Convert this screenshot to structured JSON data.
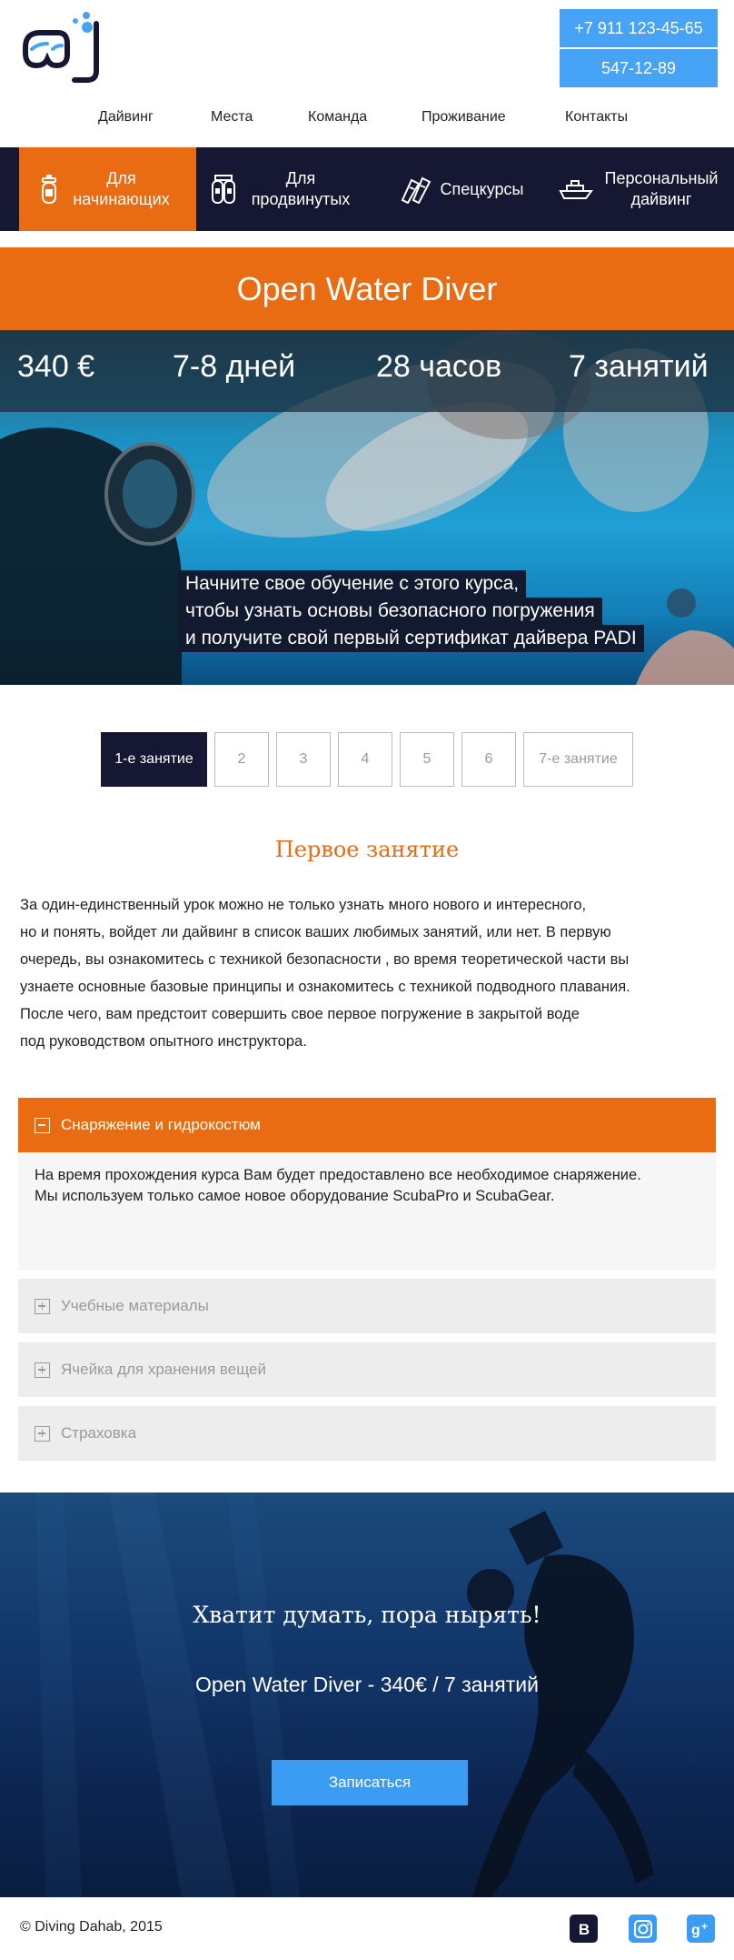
{
  "header": {
    "phones": [
      "+7 911 123-45-65",
      "547-12-89"
    ],
    "nav": [
      "Дайвинг",
      "Места",
      "Команда",
      "Проживание",
      "Контакты"
    ]
  },
  "course_tabs": [
    {
      "label": "Для начинающих",
      "icon": "scuba-tank-icon",
      "active": true
    },
    {
      "label": "Для продвинутых",
      "icon": "double-tank-icon",
      "active": false
    },
    {
      "label": "Спецкурсы",
      "icon": "fins-icon",
      "active": false
    },
    {
      "label": "Персональный дайвинг",
      "icon": "boat-icon",
      "active": false
    }
  ],
  "course": {
    "title": "Open Water Diver",
    "stats": [
      "340 €",
      "7-8 дней",
      "28 часов",
      "7 занятий"
    ],
    "hero_lines": [
      "Начните свое обучение с этого курса,",
      "чтобы узнать основы безопасного погружения",
      "и получите свой первый сертификат дайвера PADI"
    ]
  },
  "lessons": {
    "items": [
      "1-е занятие",
      "2",
      "3",
      "4",
      "5",
      "6",
      "7-е занятие"
    ],
    "active_index": 0,
    "title": "Первое занятие",
    "lines": [
      "За один-единственный урок можно не только узнать много нового и интересного,",
      "но и понять, войдет ли дайвинг в список ваших любимых занятий, или нет. В первую",
      "очередь, вы ознакомитесь с техникой безопасности , во время теоретической части вы",
      "узнаете основные базовые принципы и ознакомитесь с техникой подводного плавания.",
      "После чего, вам предстоит совершить свое первое погружение в закрытой воде",
      "под руководством опытного инструктора."
    ]
  },
  "accordion": [
    {
      "title": "Снаряжение и гидрокостюм",
      "open": true,
      "body": [
        "На время прохождения курса Вам будет предоставлено все необходимое снаряжение.",
        "Мы используем только самое новое оборудование ScubaPro и ScubaGear."
      ]
    },
    {
      "title": "Учебные материалы",
      "open": false
    },
    {
      "title": "Ячейка для хранения вещей",
      "open": false
    },
    {
      "title": "Страховка",
      "open": false
    }
  ],
  "cta": {
    "heading": "Хватит думать, пора нырять!",
    "subtitle": "Open Water Diver - 340€ / 7 занятий",
    "button": "Записаться"
  },
  "footer": {
    "copyright": "© Diving Dahab, 2015",
    "social": [
      "vk-icon",
      "instagram-icon",
      "google-plus-icon"
    ]
  },
  "colors": {
    "accent": "#e96b12",
    "navy": "#161833",
    "blue": "#46a3f5",
    "light_grey": "#ededed"
  }
}
